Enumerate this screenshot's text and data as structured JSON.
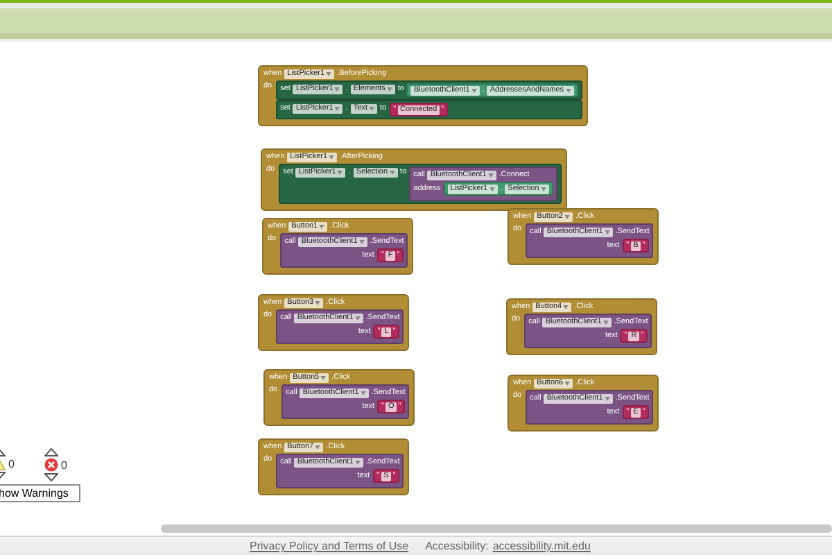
{
  "blocks": [
    {
      "when": "when",
      "component": "ListPicker1",
      "event": ".BeforePicking",
      "do": "do",
      "statements": [
        {
          "kind": "set",
          "keyword": "set",
          "component": "ListPicker1",
          "dot": ".",
          "property": "Elements",
          "to": "to",
          "value": {
            "kind": "getter",
            "component": "BluetoothClient1",
            "dot": ".",
            "property": "AddressesAndNames"
          }
        },
        {
          "kind": "set",
          "keyword": "set",
          "component": "ListPicker1",
          "dot": ".",
          "property": "Text",
          "to": "to",
          "value": {
            "kind": "string",
            "open": "\"",
            "text": "Connected",
            "close": "\""
          }
        }
      ]
    },
    {
      "when": "when",
      "component": "ListPicker1",
      "event": ".AfterPicking",
      "do": "do",
      "statements": [
        {
          "kind": "set",
          "keyword": "set",
          "component": "ListPicker1",
          "dot": ".",
          "property": "Selection",
          "to": "to",
          "value": {
            "kind": "call",
            "keyword": "call",
            "component": "BluetoothClient1",
            "method": ".Connect",
            "args": [
              {
                "name": "address",
                "value": {
                  "kind": "getter",
                  "component": "ListPicker1",
                  "dot": ".",
                  "property": "Selection"
                }
              }
            ]
          }
        }
      ]
    },
    {
      "when": "when",
      "component": "Button1",
      "event": ".Click",
      "do": "do",
      "statements": [
        {
          "kind": "call",
          "keyword": "call",
          "component": "BluetoothClient1",
          "method": ".SendText",
          "args": [
            {
              "name": "text",
              "value": {
                "kind": "string",
                "open": "\"",
                "text": "F",
                "close": "\""
              }
            }
          ]
        }
      ]
    },
    {
      "when": "when",
      "component": "Button2",
      "event": ".Click",
      "do": "do",
      "statements": [
        {
          "kind": "call",
          "keyword": "call",
          "component": "BluetoothClient1",
          "method": ".SendText",
          "args": [
            {
              "name": "text",
              "value": {
                "kind": "string",
                "open": "\"",
                "text": "B",
                "close": "\""
              }
            }
          ]
        }
      ]
    },
    {
      "when": "when",
      "component": "Button3",
      "event": ".Click",
      "do": "do",
      "statements": [
        {
          "kind": "call",
          "keyword": "call",
          "component": "BluetoothClient1",
          "method": ".SendText",
          "args": [
            {
              "name": "text",
              "value": {
                "kind": "string",
                "open": "\"",
                "text": "L",
                "close": "\""
              }
            }
          ]
        }
      ]
    },
    {
      "when": "when",
      "component": "Button4",
      "event": ".Click",
      "do": "do",
      "statements": [
        {
          "kind": "call",
          "keyword": "call",
          "component": "BluetoothClient1",
          "method": ".SendText",
          "args": [
            {
              "name": "text",
              "value": {
                "kind": "string",
                "open": "\"",
                "text": "R",
                "close": "\""
              }
            }
          ]
        }
      ]
    },
    {
      "when": "when",
      "component": "Button5",
      "event": ".Click",
      "do": "do",
      "statements": [
        {
          "kind": "call",
          "keyword": "call",
          "component": "BluetoothClient1",
          "method": ".SendText",
          "args": [
            {
              "name": "text",
              "value": {
                "kind": "string",
                "open": "\"",
                "text": "O",
                "close": "\""
              }
            }
          ]
        }
      ]
    },
    {
      "when": "when",
      "component": "Button6",
      "event": ".Click",
      "do": "do",
      "statements": [
        {
          "kind": "call",
          "keyword": "call",
          "component": "BluetoothClient1",
          "method": ".SendText",
          "args": [
            {
              "name": "text",
              "value": {
                "kind": "string",
                "open": "\"",
                "text": "E",
                "close": "\""
              }
            }
          ]
        }
      ]
    },
    {
      "when": "when",
      "component": "Button7",
      "event": ".Click",
      "do": "do",
      "statements": [
        {
          "kind": "call",
          "keyword": "call",
          "component": "BluetoothClient1",
          "method": ".SendText",
          "args": [
            {
              "name": "text",
              "value": {
                "kind": "string",
                "open": "\"",
                "text": "S",
                "close": "\""
              }
            }
          ]
        }
      ]
    }
  ],
  "warnings": {
    "warning_count": "0",
    "error_count": "0",
    "button": "how Warnings"
  },
  "footer": {
    "privacy": "Privacy Policy and Terms of Use",
    "accessibility_label": "Accessibility:",
    "accessibility_link": "accessibility.mit.edu"
  }
}
